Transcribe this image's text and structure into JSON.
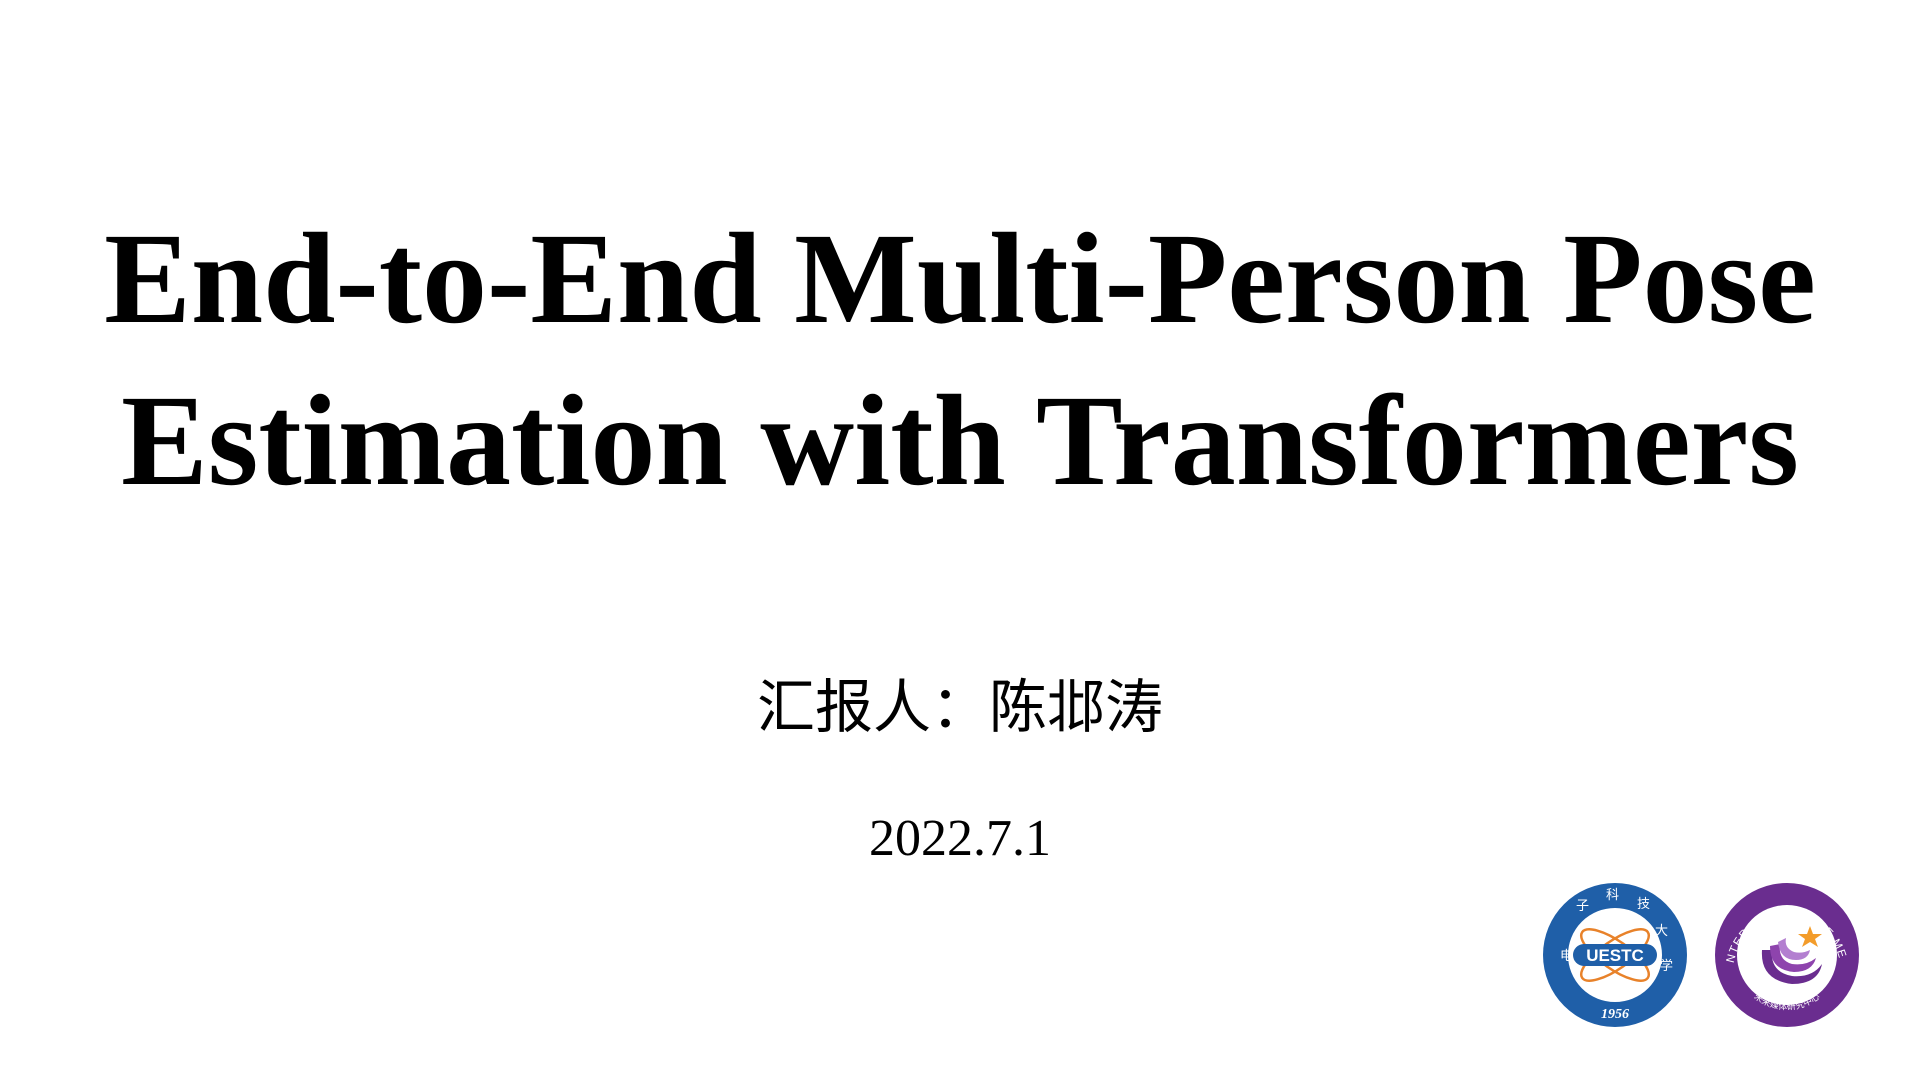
{
  "slide": {
    "title_lines": [
      "End-to-End Multi-Person Pose",
      "Estimation with Transformers"
    ],
    "presenter": "汇报人：陈邶涛",
    "date": "2022.7.1"
  },
  "logos": {
    "uestc": {
      "name": "UESTC logo",
      "text": "UESTC",
      "year": "1956",
      "chinese": "电子科技大学",
      "colors": {
        "ring": "#1f5fa8",
        "inner": "#ffffff",
        "accent": "#e8822a"
      }
    },
    "cfm": {
      "name": "Center for Future Media logo",
      "ring_text": "CENTER FOR FUTURE MEDIA",
      "chinese": "未来媒体研究中心",
      "colors": {
        "ring": "#6a2d8f",
        "inner": "#ffffff",
        "accent": "#f39c2a"
      }
    }
  }
}
